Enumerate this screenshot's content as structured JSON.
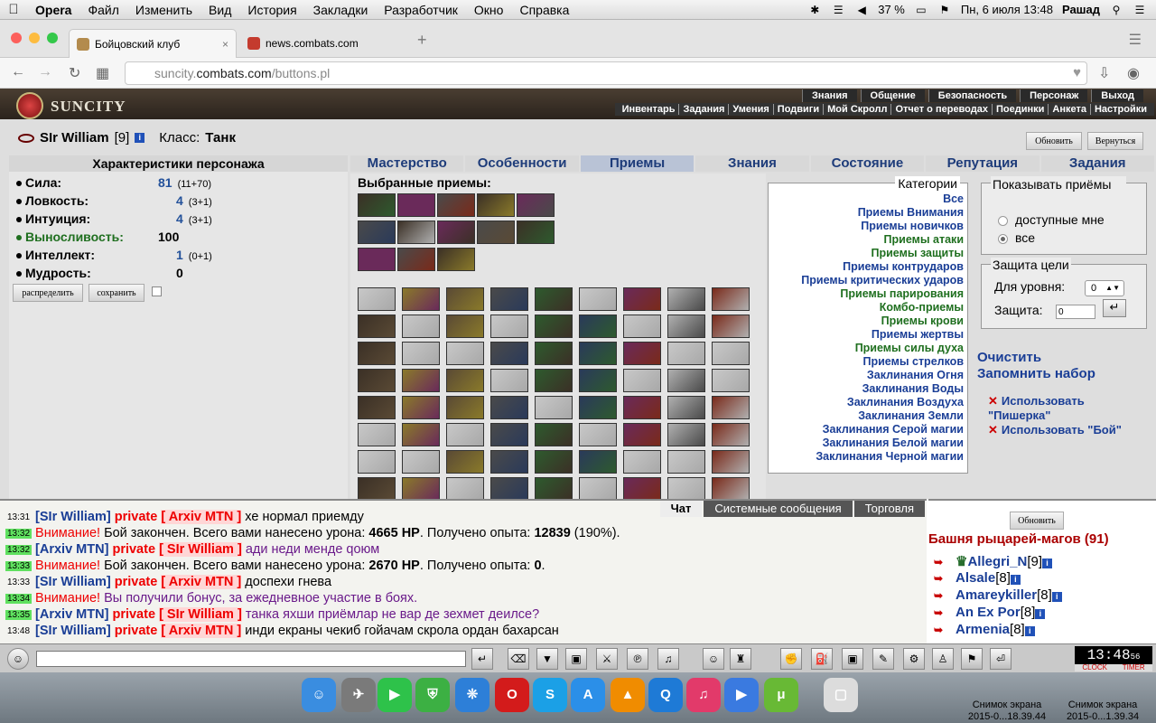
{
  "menubar": {
    "app": "Opera",
    "items": [
      "Файл",
      "Изменить",
      "Вид",
      "История",
      "Закладки",
      "Разработчик",
      "Окно",
      "Справка"
    ],
    "battery": "37 %",
    "datetime": "Пн, 6 июля  13:48",
    "user": "Рашад"
  },
  "tabs": [
    {
      "title": "Бойцовский клуб",
      "active": true
    },
    {
      "title": "news.combats.com",
      "active": false
    }
  ],
  "address": {
    "domain": "suncity.",
    "host": "combats.com",
    "path": "/buttons.pl"
  },
  "game": {
    "logo": "SUNCITY",
    "topnav": [
      "Знания",
      "Общение",
      "Безопасность",
      "Персонаж",
      "Выход"
    ],
    "subnav": [
      "Инвентарь",
      "Задания",
      "Умения",
      "Подвиги",
      "Мой Скролл",
      "Отчет о переводах",
      "Поединки",
      "Анкета",
      "Настройки"
    ]
  },
  "character": {
    "name": "SIr William",
    "level": "[9]",
    "class_label": "Класс:",
    "class_value": "Танк",
    "refresh_btn": "Обновить",
    "back_btn": "Вернуться",
    "panel_title": "Характеристики персонажа",
    "stats": [
      {
        "name": "Сила:",
        "value": "81",
        "extra": "(11+70)"
      },
      {
        "name": "Ловкость:",
        "value": "4",
        "extra": "(3+1)"
      },
      {
        "name": "Интуиция:",
        "value": "4",
        "extra": "(3+1)"
      },
      {
        "name": "Выносливость:",
        "value": "100",
        "extra": ""
      },
      {
        "name": "Интеллект:",
        "value": "1",
        "extra": "(0+1)"
      },
      {
        "name": "Мудрость:",
        "value": "0",
        "extra": ""
      }
    ],
    "distribute_btn": "распределить",
    "save_btn": "сохранить"
  },
  "skill_tabs": [
    "Мастерство",
    "Особенности",
    "Приемы",
    "Знания",
    "Состояние",
    "Репутация",
    "Задания"
  ],
  "selected_title": "Выбранные приемы:",
  "categories": {
    "legend": "Категории",
    "items": [
      {
        "label": "Все",
        "color": "b"
      },
      {
        "label": "Приемы Внимания",
        "color": "b"
      },
      {
        "label": "Приемы новичков",
        "color": "b"
      },
      {
        "label": "Приемы атаки",
        "color": "g"
      },
      {
        "label": "Приемы защиты",
        "color": "g"
      },
      {
        "label": "Приемы контрударов",
        "color": "b"
      },
      {
        "label": "Приемы критических ударов",
        "color": "b"
      },
      {
        "label": "Приемы парирования",
        "color": "g"
      },
      {
        "label": "Комбо-приемы",
        "color": "g"
      },
      {
        "label": "Приемы крови",
        "color": "g"
      },
      {
        "label": "Приемы жертвы",
        "color": "b"
      },
      {
        "label": "Приемы силы духа",
        "color": "g"
      },
      {
        "label": "Приемы стрелков",
        "color": "b"
      },
      {
        "label": "Заклинания Огня",
        "color": "b"
      },
      {
        "label": "Заклинания Воды",
        "color": "b"
      },
      {
        "label": "Заклинания Воздуха",
        "color": "b"
      },
      {
        "label": "Заклинания Земли",
        "color": "b"
      },
      {
        "label": "Заклинания Серой магии",
        "color": "b"
      },
      {
        "label": "Заклинания Белой магии",
        "color": "b"
      },
      {
        "label": "Заклинания Черной магии",
        "color": "b"
      }
    ]
  },
  "show": {
    "title": "Показывать приёмы",
    "opt1": "доступные мне",
    "opt2": "все"
  },
  "protect": {
    "title": "Защита цели",
    "level_label": "Для уровня:",
    "level_value": "0",
    "prot_label": "Защита:",
    "prot_value": "0"
  },
  "links": {
    "clear": "Очистить",
    "remember": "Запомнить набор",
    "use1a": "Использовать",
    "use1b": "\"Пишерка\"",
    "use2": "Использовать \"Бой\""
  },
  "chat": {
    "tabs": [
      "Чат",
      "Системные сообщения",
      "Торговля"
    ],
    "lines": [
      {
        "ts": "13:31",
        "tsg": false,
        "nick": "SIr William",
        "to": "Arxiv MTN",
        "text": "хе нормал приемду",
        "tclass": ""
      },
      {
        "ts": "13:32",
        "tsg": true,
        "warn": "Внимание!",
        "text": " Бой закончен. Всего вами нанесено урона: ",
        "b1": "4665 HP",
        "t2": ". Получено опыта: ",
        "b2": "12839",
        "t3": " (190%)."
      },
      {
        "ts": "13:32",
        "tsg": true,
        "nick": "Arxiv MTN",
        "to": "SIr William",
        "text": "ади неди менде qoюм",
        "tclass": "purple"
      },
      {
        "ts": "13:33",
        "tsg": true,
        "warn": "Внимание!",
        "text": " Бой закончен. Всего вами нанесено урона: ",
        "b1": "2670 HP",
        "t2": ". Получено опыта: ",
        "b2": "0",
        "t3": "."
      },
      {
        "ts": "13:33",
        "tsg": false,
        "nick": "SIr William",
        "to": "Arxiv MTN",
        "text": "доспехи гнева",
        "tclass": ""
      },
      {
        "ts": "13:34",
        "tsg": true,
        "warn": "Внимание!",
        "text": " Вы получили бонус, за ежедневное участие в боях.",
        "tclass": "purple"
      },
      {
        "ts": "13:35",
        "tsg": true,
        "nick": "Arxiv MTN",
        "to": "SIr William",
        "text": "танка яхши приёмлар не вар де зехмет деилсе?",
        "tclass": "purple"
      },
      {
        "ts": "13:48",
        "tsg": false,
        "nick": "SIr William",
        "to": "Arxiv MTN",
        "text": "инди екраны чекиб гойачам скрола ордан бахарсан",
        "tclass": ""
      }
    ],
    "private_word": "private"
  },
  "online": {
    "refresh_btn": "Обновить",
    "room": "Башня рыцарей-магов (91)",
    "users": [
      {
        "name": "Allegri_N",
        "level": "[9]"
      },
      {
        "name": "Alsale",
        "level": "[8]"
      },
      {
        "name": "Amareykiller",
        "level": "[8]"
      },
      {
        "name": "An Ex Por",
        "level": "[8]"
      },
      {
        "name": "Armenia",
        "level": "[8]"
      }
    ]
  },
  "clock": {
    "time": "13:48",
    "sec": "56",
    "label1": "CLOCK",
    "label2": "TIMER"
  },
  "dock": {
    "label1a": "Снимок экрана",
    "label1b": "2015-0...18.39.44",
    "label2a": "Снимок экрана",
    "label2b": "2015-0...1.39.34"
  }
}
